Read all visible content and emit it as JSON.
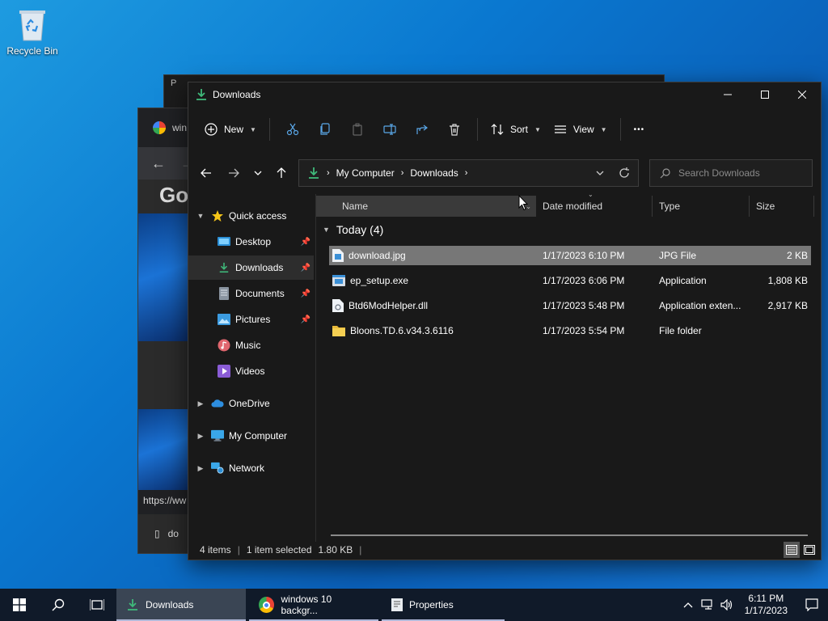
{
  "desktop": {
    "icons": [
      {
        "label": "Recycle Bin",
        "icon": "recycle-bin-icon"
      }
    ]
  },
  "background_windows": {
    "properties": {
      "title": "P"
    },
    "chrome": {
      "tab_title": "win",
      "logo_text": "Go",
      "url": "https://ww",
      "download_item": "do"
    }
  },
  "explorer": {
    "title": "Downloads",
    "window_controls": {
      "minimize": "—",
      "maximize": "☐",
      "close": "✕"
    },
    "toolbar": {
      "new_label": "New",
      "sort_label": "Sort",
      "view_label": "View",
      "more_label": "•••"
    },
    "address": {
      "crumbs": [
        "My Computer",
        "Downloads"
      ]
    },
    "search": {
      "placeholder": "Search Downloads"
    },
    "sidebar": {
      "quick_access_label": "Quick access",
      "items": [
        {
          "label": "Desktop",
          "pinned": true
        },
        {
          "label": "Downloads",
          "pinned": true
        },
        {
          "label": "Documents",
          "pinned": true
        },
        {
          "label": "Pictures",
          "pinned": true
        },
        {
          "label": "Music",
          "pinned": false
        },
        {
          "label": "Videos",
          "pinned": false
        }
      ],
      "roots": [
        {
          "label": "OneDrive"
        },
        {
          "label": "My Computer"
        },
        {
          "label": "Network"
        }
      ]
    },
    "columns": {
      "name": "Name",
      "date": "Date modified",
      "type": "Type",
      "size": "Size"
    },
    "group_label": "Today (4)",
    "files": [
      {
        "name": "download.jpg",
        "date": "1/17/2023 6:10 PM",
        "type": "JPG File",
        "size": "2 KB",
        "selected": true,
        "icon": "image-file-icon"
      },
      {
        "name": "ep_setup.exe",
        "date": "1/17/2023 6:06 PM",
        "type": "Application",
        "size": "1,808 KB",
        "selected": false,
        "icon": "exe-file-icon"
      },
      {
        "name": "Btd6ModHelper.dll",
        "date": "1/17/2023 5:48 PM",
        "type": "Application exten...",
        "size": "2,917 KB",
        "selected": false,
        "icon": "dll-file-icon"
      },
      {
        "name": "Bloons.TD.6.v34.3.6116",
        "date": "1/17/2023 5:54 PM",
        "type": "File folder",
        "size": "",
        "selected": false,
        "icon": "folder-icon"
      }
    ],
    "status": {
      "item_count": "4 items",
      "selection": "1 item selected",
      "selection_size": "1.80 KB"
    }
  },
  "taskbar": {
    "apps": [
      {
        "label": "Downloads",
        "active": true
      },
      {
        "label": "windows 10 backgr...",
        "active": false
      },
      {
        "label": "Properties",
        "active": false
      }
    ],
    "clock": {
      "time": "6:11 PM",
      "date": "1/17/2023"
    }
  },
  "colors": {
    "accent_green": "#3fb97a",
    "selection": "#777777",
    "window_bg": "#191919",
    "taskbar_bg": "#101a29"
  }
}
